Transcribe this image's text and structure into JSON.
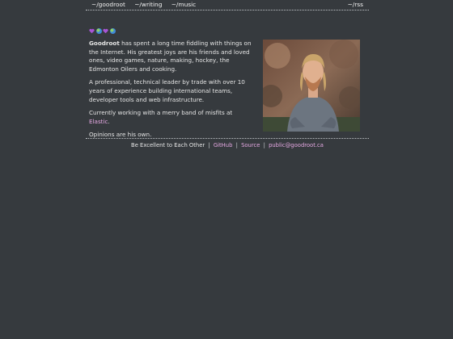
{
  "nav": {
    "home": "~/goodroot",
    "writing": "~/writing",
    "music": "~/music",
    "rss": "~/rss"
  },
  "emojis": [
    "purple-heart-icon",
    "earth-globe-icon",
    "purple-heart-icon",
    "earth-globe-icon"
  ],
  "bio": {
    "name": "Goodroot",
    "p1_rest": " has spent a long time fiddling with things on the Internet. His greatest joys are his friends and loved ones, video games, nature, making, hockey, the Edmonton Oilers and cooking.",
    "p2": "A professional, technical leader by trade with over 10 years of experience building international teams, developer tools and web infrastructure.",
    "p3_prefix": "Currently working with a merry band of misfits at ",
    "p3_link": "Elastic",
    "p3_suffix": ".",
    "p4": "Opinions are his own."
  },
  "footer": {
    "motto": "Be Excellent to Each Other",
    "sep": "|",
    "github": "GitHub",
    "source": "Source",
    "email": "public@goodroot.ca"
  },
  "colors": {
    "background": "#363a3e",
    "text": "#e6e6e6",
    "link": "#e5a8e2",
    "heart": "#a855d6"
  }
}
